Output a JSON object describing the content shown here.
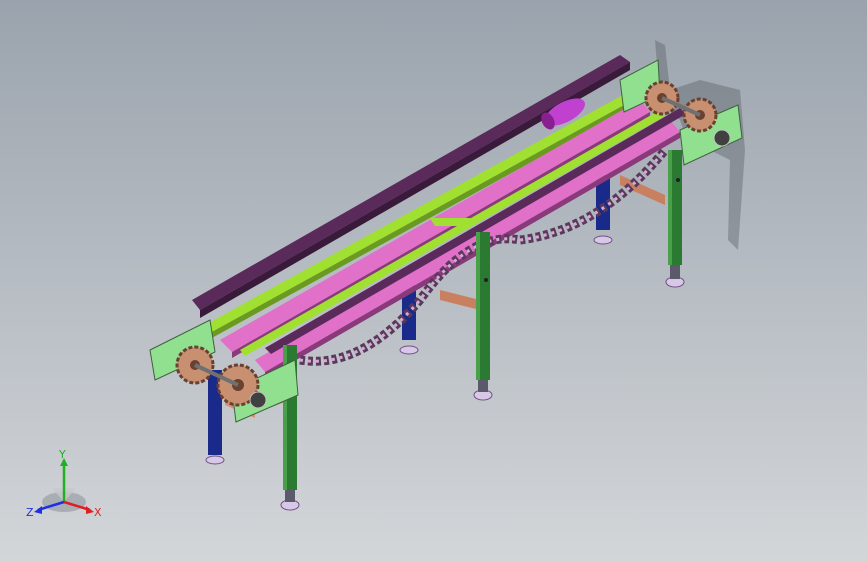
{
  "triad": {
    "x_label": "X",
    "y_label": "Y",
    "z_label": "Z",
    "x_color": "#e02020",
    "y_color": "#20b020",
    "z_color": "#2030e0"
  },
  "model": {
    "frame_color": "#3a8a3a",
    "leg_color": "#2a7a32",
    "inner_leg_color": "#1a2a8a",
    "rail_color": "#5a2a5a",
    "slat_color": "#e070c8",
    "plate_color": "#90e090",
    "crossbar_color": "#c88060",
    "sprocket_color": "#c89070",
    "support_color": "#a0e030",
    "motor_color": "#c040d0"
  }
}
